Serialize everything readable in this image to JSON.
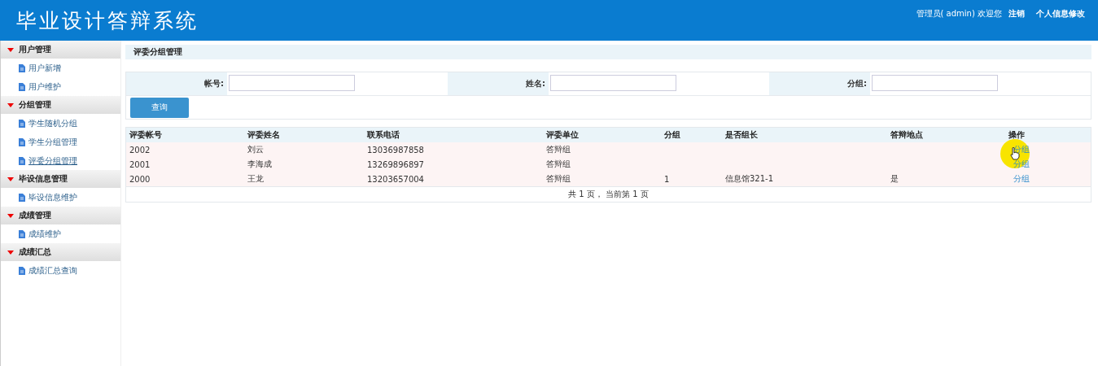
{
  "header": {
    "title": "毕业设计答辩系统",
    "user_text": "管理员( admin) 欢迎您",
    "links": [
      "注销",
      "个人信息修改"
    ]
  },
  "sidebar": {
    "groups": [
      {
        "label": "用户管理",
        "items": [
          {
            "label": "用户新增",
            "selected": false
          },
          {
            "label": "用户维护",
            "selected": false
          }
        ]
      },
      {
        "label": "分组管理",
        "items": [
          {
            "label": "学生随机分组",
            "selected": false
          },
          {
            "label": "学生分组管理",
            "selected": false
          },
          {
            "label": "评委分组管理",
            "selected": true
          }
        ]
      },
      {
        "label": "毕设信息管理",
        "items": [
          {
            "label": "毕设信息维护",
            "selected": false
          }
        ]
      },
      {
        "label": "成绩管理",
        "items": [
          {
            "label": "成绩维护",
            "selected": false
          }
        ]
      },
      {
        "label": "成绩汇总",
        "items": [
          {
            "label": "成绩汇总查询",
            "selected": false
          }
        ]
      }
    ]
  },
  "page_title": "评委分组管理",
  "search": {
    "fields": [
      {
        "label": "帐号:"
      },
      {
        "label": "姓名:"
      },
      {
        "label": "分组:"
      }
    ],
    "button": "查询"
  },
  "table": {
    "columns": [
      "评委帐号",
      "评委姓名",
      "联系电话",
      "评委单位",
      "分组",
      "是否组长",
      "答辩地点",
      "操作"
    ],
    "rows": [
      {
        "cells": [
          "2002",
          "刘云",
          "13036987858",
          "答辩组",
          "",
          "",
          "",
          ""
        ],
        "action": "分组",
        "hovered": true
      },
      {
        "cells": [
          "2001",
          "李海成",
          "13269896897",
          "答辩组",
          "",
          "",
          "",
          ""
        ],
        "action": "分组",
        "hovered": false
      },
      {
        "cells": [
          "2000",
          "王龙",
          "13203657004",
          "答辩组",
          "1",
          "信息馆321-1",
          "是",
          ""
        ],
        "action": "分组",
        "hovered": false
      }
    ],
    "pagination": "共 1 页， 当前第 1 页"
  }
}
